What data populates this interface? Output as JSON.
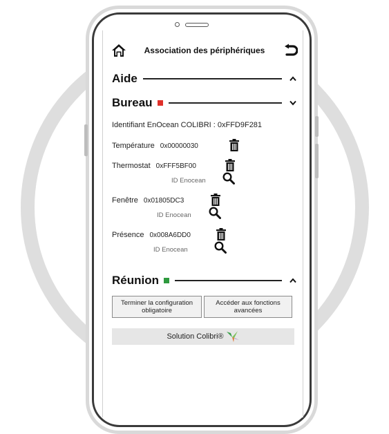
{
  "header": {
    "title": "Association des périphériques",
    "home_icon": "home-icon",
    "back_icon": "undo-arrow-icon"
  },
  "sections": {
    "aide": {
      "title": "Aide",
      "expanded": false
    },
    "bureau": {
      "title": "Bureau",
      "status_color": "#e0302a",
      "expanded": true,
      "identifier_line": "Identifiant EnOcean COLIBRI : 0xFFD9F281",
      "devices": [
        {
          "label": "Température",
          "id": "0x00000030",
          "sub_label": ""
        },
        {
          "label": "Thermostat",
          "id": "0xFFF5BF00",
          "sub_label": "ID Enocean"
        },
        {
          "label": "Fenêtre",
          "id": "0x01805DC3",
          "sub_label": "ID Enocean"
        },
        {
          "label": "Présence",
          "id": "0x008A6DD0",
          "sub_label": "ID Enocean"
        }
      ]
    },
    "reunion": {
      "title": "Réunion",
      "status_color": "#2e9a3e",
      "expanded": false
    }
  },
  "buttons": {
    "finish_label": "Terminer la configuration obligatoire",
    "advanced_label": "Accéder aux fonctions avancées"
  },
  "footer": {
    "label": "Solution Colibri®",
    "logo_icon": "colibri-bird-icon"
  }
}
